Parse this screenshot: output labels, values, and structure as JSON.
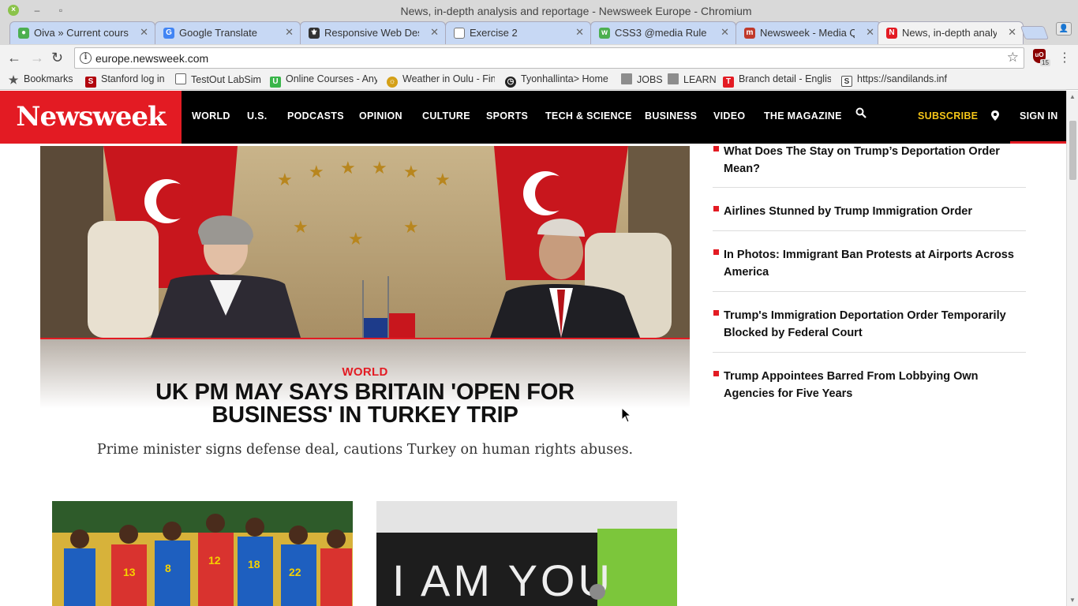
{
  "window": {
    "title": "News, in-depth analysis and reportage - Newsweek Europe - Chromium"
  },
  "tabs": [
    {
      "label": "Oiva » Current course",
      "color": "#4caf50",
      "active": false
    },
    {
      "label": "Google Translate",
      "color": "#4285f4",
      "active": false
    },
    {
      "label": "Responsive Web Desi",
      "color": "#333333",
      "active": false
    },
    {
      "label": "Exercise 2",
      "color": "#888888",
      "active": false
    },
    {
      "label": "CSS3 @media Rule",
      "color": "#4caf50",
      "active": false
    },
    {
      "label": "Newsweek - Media Q",
      "color": "#c0392b",
      "active": false
    },
    {
      "label": "News, in-depth analys",
      "color": "#e31b23",
      "active": true
    }
  ],
  "toolbar": {
    "url": "europe.newsweek.com",
    "ext_badge": "15"
  },
  "bookmarks": [
    {
      "label": "Bookmarks",
      "icon": "star-icon"
    },
    {
      "label": "Stanford log in",
      "icon": "stanford-icon"
    },
    {
      "label": "TestOut LabSim",
      "icon": "page-icon"
    },
    {
      "label": "Online Courses - Any",
      "icon": "udemy-icon"
    },
    {
      "label": "Weather in Oulu - Fin",
      "icon": "weather-icon"
    },
    {
      "label": "Tyonhallinta> Home",
      "icon": "clock-icon"
    },
    {
      "label": "JOBS",
      "icon": "folder-icon"
    },
    {
      "label": "LEARN",
      "icon": "folder-icon"
    },
    {
      "label": "Branch detail - Englis",
      "icon": "branch-icon"
    },
    {
      "label": "https://sandilands.inf",
      "icon": "sandilands-icon"
    }
  ],
  "site": {
    "logo": "Newsweek",
    "nav": [
      "WORLD",
      "U.S.",
      "PODCASTS",
      "OPINION",
      "CULTURE",
      "SPORTS",
      "TECH & SCIENCE",
      "BUSINESS",
      "VIDEO",
      "THE MAGAZINE"
    ],
    "subscribe": "SUBSCRIBE",
    "sign_in": "SIGN IN",
    "accent": "#e31b23"
  },
  "hero": {
    "section": "WORLD",
    "headline": "UK PM MAY SAYS BRITAIN 'OPEN FOR BUSINESS' IN TURKEY TRIP",
    "summary": "Prime minister signs defense deal, cautions Turkey on human rights abuses."
  },
  "sidebar": {
    "stories": [
      "What Does The Stay on Trump’s Deportation Order Mean?",
      "Airlines Stunned by Trump Immigration Order",
      "In Photos: Immigrant Ban Protests at Airports Across America",
      "Trump's Immigration Deportation Order Temporarily Blocked by Federal Court",
      "Trump Appointees Barred From Lobbying Own Agencies for Five Years"
    ]
  },
  "thumbnails": {
    "snow_sign_text": "I AM YOU"
  }
}
